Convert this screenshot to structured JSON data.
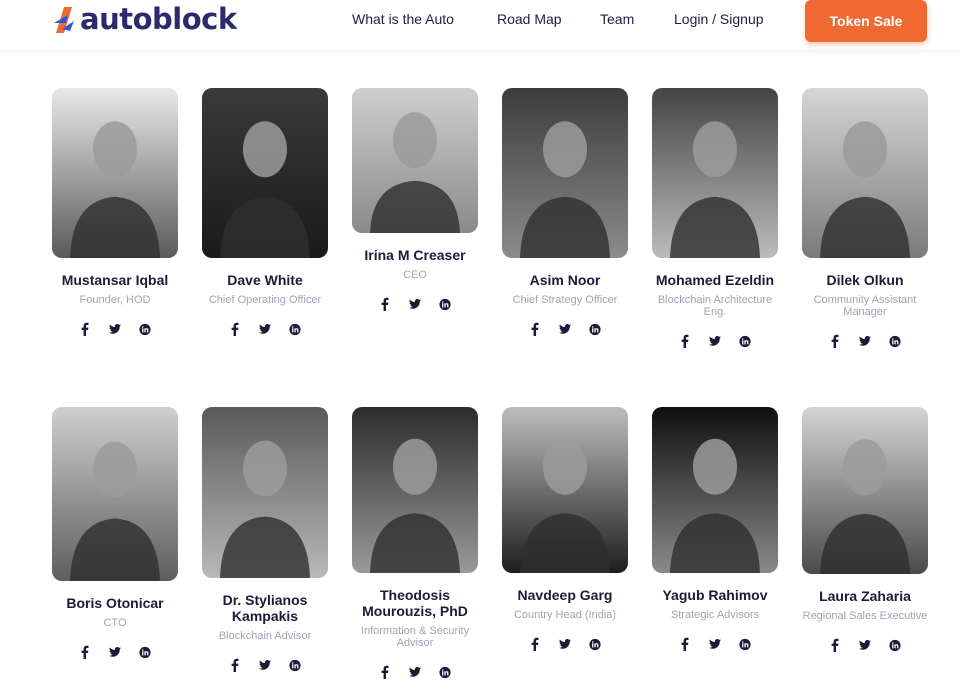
{
  "brand": {
    "name": "autoblock",
    "text_color": "#2d2a6b",
    "mark_colors": [
      "#ef6a32",
      "#2d57d8"
    ]
  },
  "nav": {
    "items": [
      "What is the Auto",
      "Road Map",
      "Team",
      "Login / Signup"
    ],
    "cta": "Token Sale",
    "cta_color": "#ef6a32"
  },
  "team": [
    {
      "name": "Mustansar Iqbal",
      "role": "Founder, HOD"
    },
    {
      "name": "Dave White",
      "role": "Chief Operating Officer"
    },
    {
      "name": "Irina M Creaser",
      "role": "CEO"
    },
    {
      "name": "Asim Noor",
      "role": "Chief Strategy Officer"
    },
    {
      "name": "Mohamed Ezeldin",
      "role": "Blockchain Architecture Eng."
    },
    {
      "name": "Dilek Olkun",
      "role": "Community Assistant Manager"
    },
    {
      "name": "Boris Otonicar",
      "role": "CTO"
    },
    {
      "name": "Dr. Stylianos Kampakis",
      "role": "Blockchain Advisor"
    },
    {
      "name": "Theodosis Mourouzis, PhD",
      "role": "Information & Security Advisor"
    },
    {
      "name": "Navdeep Garg",
      "role": "Country Head (India)"
    },
    {
      "name": "Yagub Rahimov",
      "role": "Strategic Advisors"
    },
    {
      "name": "Laura Zaharia",
      "role": "Regional Sales Executive"
    }
  ],
  "social_icons": [
    "facebook-icon",
    "twitter-icon",
    "linkedin-icon"
  ]
}
